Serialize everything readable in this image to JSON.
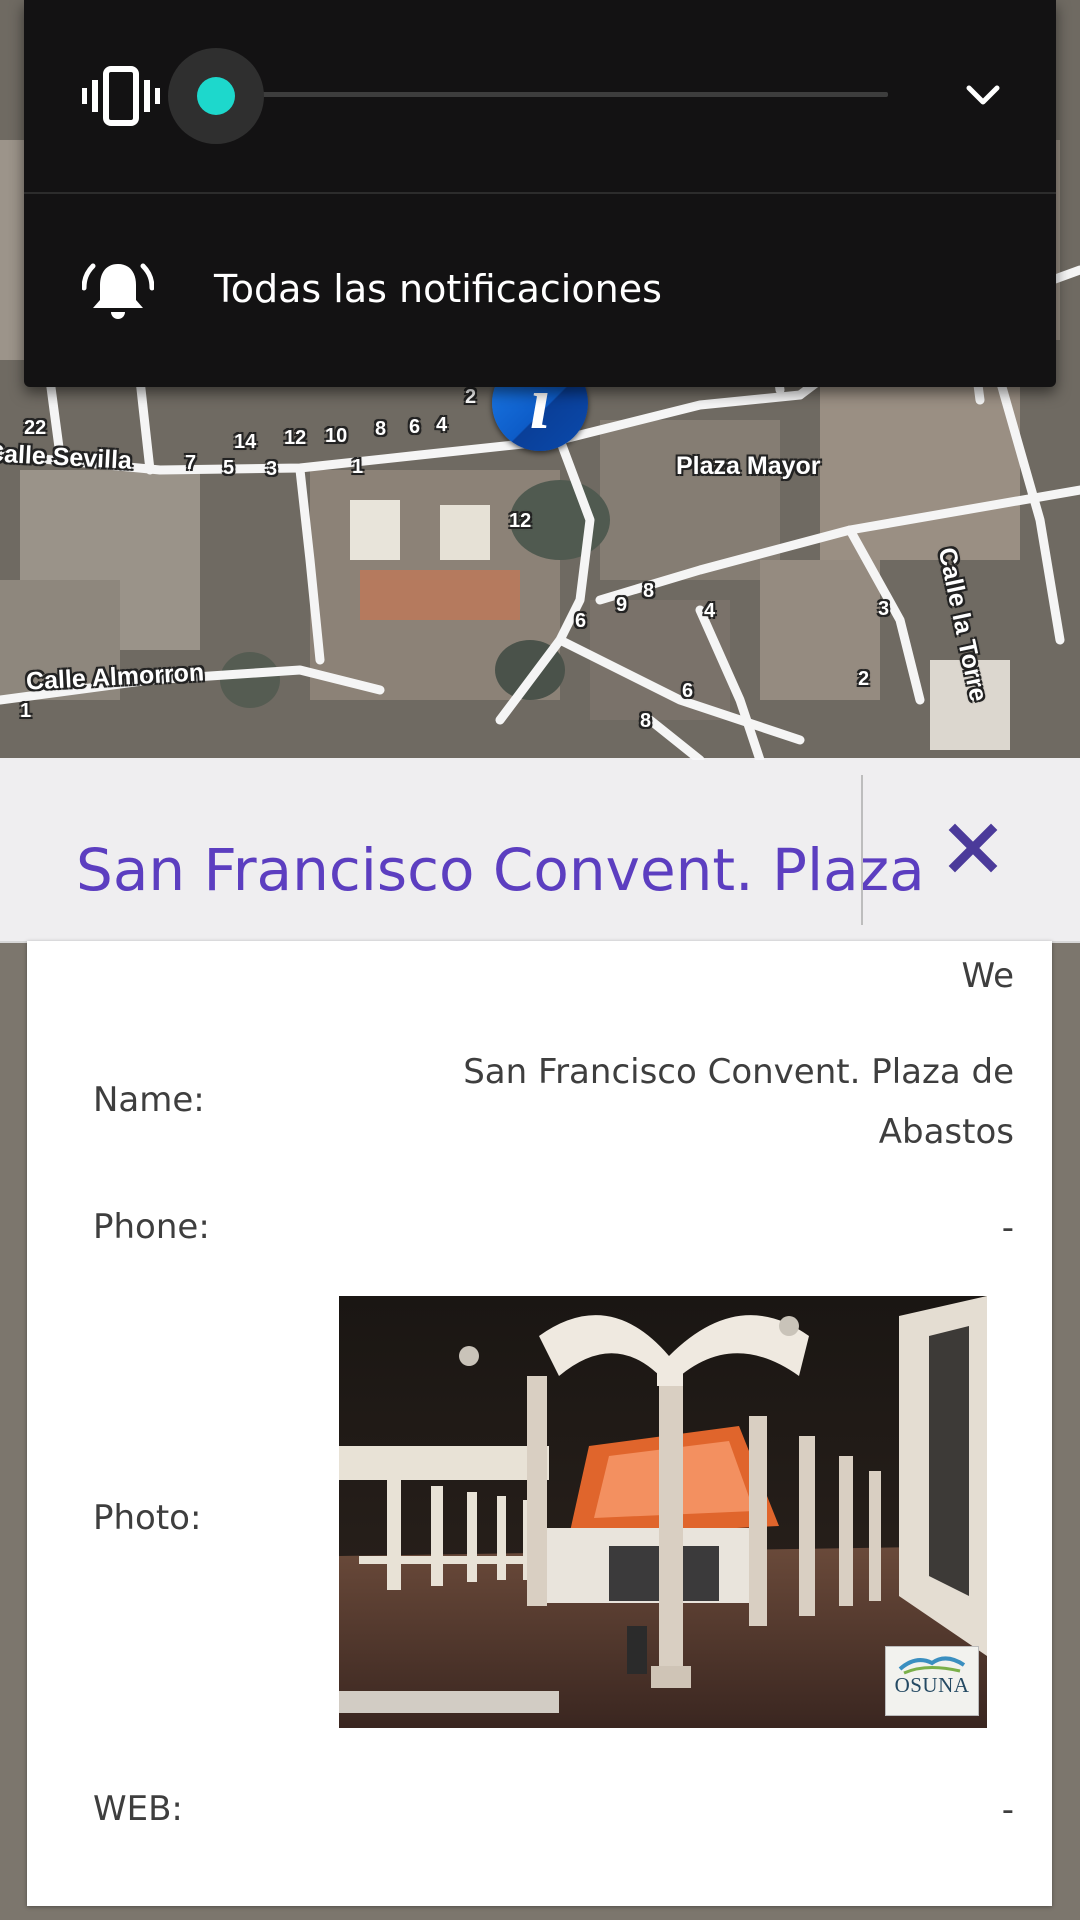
{
  "map": {
    "streets": [
      "Calle Sevilla",
      "Plaza Mayor",
      "Calle Almorron",
      "Calle la Torre"
    ],
    "street_numbers": [
      "22",
      "14",
      "12",
      "10",
      "8",
      "6",
      "4",
      "2",
      "7",
      "5",
      "3",
      "1",
      "12",
      "6",
      "9",
      "8",
      "4",
      "3",
      "6",
      "2",
      "8",
      "1"
    ],
    "marker_symbol": "i",
    "marker_icon": "info-marker-icon"
  },
  "volume_panel": {
    "mode_icon": "vibrate-icon",
    "volume_level": 0,
    "expand_icon": "chevron-down-icon",
    "notification_icon": "bell-ringing-icon",
    "notification_label": "Todas las notificaciones",
    "accent_color": "#1dd8cc"
  },
  "place": {
    "title": "San Francisco Convent. Plaza",
    "title_color": "#5c3ec0",
    "close_icon": "close-icon",
    "partial_text": "We",
    "rows": {
      "name_label": "Name:",
      "name_value_line1": "San Francisco Convent. Plaza de",
      "name_value_line2": "Abastos",
      "phone_label": "Phone:",
      "phone_value": "-",
      "photo_label": "Photo:",
      "web_label": "WEB:",
      "web_value": "-"
    },
    "photo_logo": "OSUNA"
  }
}
